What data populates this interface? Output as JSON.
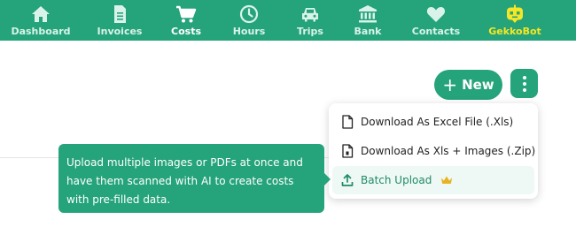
{
  "nav": {
    "items": [
      {
        "label": "Dashboard",
        "icon": "home-icon"
      },
      {
        "label": "Invoices",
        "icon": "document-icon"
      },
      {
        "label": "Costs",
        "icon": "cart-icon",
        "active": true
      },
      {
        "label": "Hours",
        "icon": "clock-icon"
      },
      {
        "label": "Trips",
        "icon": "car-icon"
      },
      {
        "label": "Bank",
        "icon": "bank-icon"
      },
      {
        "label": "Contacts",
        "icon": "heart-icon"
      },
      {
        "label": "GekkoBot",
        "icon": "robot-icon"
      }
    ]
  },
  "toolbar": {
    "new_label": "New"
  },
  "menu": {
    "items": [
      {
        "label": "Download As Excel File (.Xls)",
        "icon": "file-icon"
      },
      {
        "label": "Download As Xls + Images (.Zip)",
        "icon": "file-icon"
      },
      {
        "label": "Batch Upload",
        "icon": "upload-icon",
        "badge_icon": "crown-icon"
      }
    ]
  },
  "tooltip": {
    "text": "Upload multiple images or PDFs at once and have them scanned with AI to create costs with pre-filled data."
  },
  "colors": {
    "brand_green": "#25a37a",
    "gekko_yellow": "#f5e626",
    "crown_gold": "#e9b320"
  }
}
